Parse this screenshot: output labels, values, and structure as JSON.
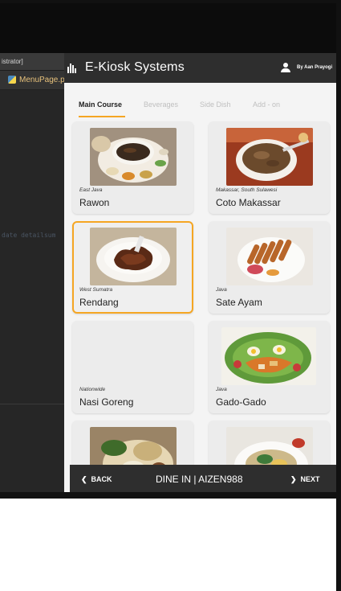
{
  "ide": {
    "title_fragment": "istrator]",
    "tab_file": "MenuPage.py",
    "code_fragment": "date detailsum"
  },
  "app": {
    "title": "E-Kiosk Systems",
    "user_name": "By Aan Prayogi",
    "tabs": [
      {
        "label": "Main Course",
        "active": true
      },
      {
        "label": "Beverages",
        "active": false
      },
      {
        "label": "Side Dish",
        "active": false
      },
      {
        "label": "Add - on",
        "active": false
      }
    ],
    "menu_items": [
      {
        "region": "East Java",
        "name": "Rawon",
        "selected": false,
        "photo": "rawon-photo"
      },
      {
        "region": "Makassar, South Sulawesi",
        "name": "Coto Makassar",
        "selected": false,
        "photo": "coto-makassar-photo"
      },
      {
        "region": "West Sumatra",
        "name": "Rendang",
        "selected": true,
        "photo": "rendang-photo"
      },
      {
        "region": "Java",
        "name": "Sate Ayam",
        "selected": false,
        "photo": "sate-ayam-photo"
      },
      {
        "region": "Nationwide",
        "name": "Nasi Goreng",
        "selected": false,
        "photo": ""
      },
      {
        "region": "Java",
        "name": "Gado-Gado",
        "selected": false,
        "photo": "gado-gado-photo"
      },
      {
        "region": "",
        "name": "",
        "selected": false,
        "photo": "partial-dish-photo"
      },
      {
        "region": "",
        "name": "",
        "selected": false,
        "photo": "partial-dish-photo"
      }
    ],
    "footer": {
      "back_label": "BACK",
      "order_label": "DINE IN | AIZEN988",
      "next_label": "NEXT"
    }
  },
  "colors": {
    "accent": "#f5a623",
    "header_bg": "#2e2e2e",
    "page_bg": "#f4f4f4"
  }
}
